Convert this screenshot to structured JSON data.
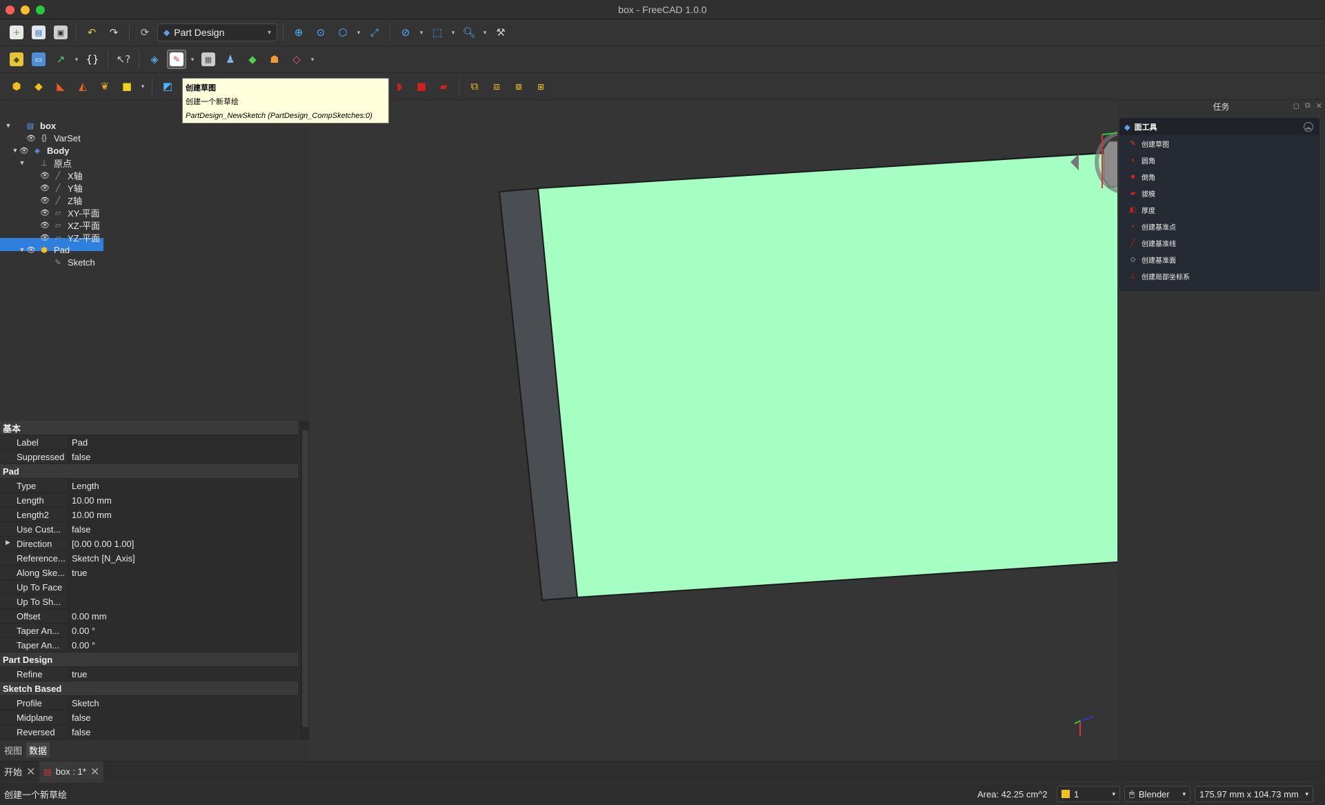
{
  "window": {
    "title": "box - FreeCAD 1.0.0"
  },
  "traffic_colors": [
    "#ff5f57",
    "#febc2e",
    "#28c840"
  ],
  "workbench": {
    "selected": "Part Design"
  },
  "tooltip": {
    "title": "创建草图",
    "description": "创建一个新草绘",
    "command": "PartDesign_NewSketch (PartDesign_CompSketches:0)"
  },
  "tree": {
    "rows": [
      {
        "label": "box",
        "depth": 0,
        "arrow": "▼",
        "eye": "",
        "icon": "document-icon",
        "bold": true
      },
      {
        "label": "VarSet",
        "depth": 2,
        "arrow": "",
        "eye": "👁",
        "icon": "braces-icon",
        "bold": false
      },
      {
        "label": "Body",
        "depth": 1,
        "arrow": "▼",
        "eye": "👁",
        "icon": "body-icon",
        "bold": true
      },
      {
        "label": "原点",
        "depth": 2,
        "arrow": "▼",
        "eye": "",
        "icon": "origin-icon",
        "bold": false
      },
      {
        "label": "X轴",
        "depth": 4,
        "arrow": "",
        "eye": "👁",
        "icon": "axis-icon",
        "bold": false
      },
      {
        "label": "Y轴",
        "depth": 4,
        "arrow": "",
        "eye": "👁",
        "icon": "axis-icon",
        "bold": false
      },
      {
        "label": "Z轴",
        "depth": 4,
        "arrow": "",
        "eye": "👁",
        "icon": "axis-icon",
        "bold": false
      },
      {
        "label": "XY-平面",
        "depth": 4,
        "arrow": "",
        "eye": "👁",
        "icon": "plane-icon",
        "bold": false
      },
      {
        "label": "XZ-平面",
        "depth": 4,
        "arrow": "",
        "eye": "👁",
        "icon": "plane-icon",
        "bold": false
      },
      {
        "label": "YZ-平面",
        "depth": 4,
        "arrow": "",
        "eye": "👁",
        "icon": "plane-icon",
        "bold": false
      },
      {
        "label": "Pad",
        "depth": 2,
        "arrow": "▼",
        "eye": "👁",
        "icon": "pad-icon",
        "bold": false
      },
      {
        "label": "Sketch",
        "depth": 4,
        "arrow": "",
        "eye": "",
        "icon": "sketch-icon",
        "bold": false
      }
    ]
  },
  "properties": {
    "rows": [
      {
        "group": "基本"
      },
      {
        "k": "Label",
        "v": "Pad"
      },
      {
        "k": "Suppressed",
        "v": "false"
      },
      {
        "group": "Pad"
      },
      {
        "k": "Type",
        "v": "Length"
      },
      {
        "k": "Length",
        "v": "10.00 mm"
      },
      {
        "k": "Length2",
        "v": "10.00 mm"
      },
      {
        "k": "Use Cust...",
        "v": "false"
      },
      {
        "k": "Direction",
        "v": "[0.00 0.00 1.00]",
        "expand": "▶"
      },
      {
        "k": "Reference...",
        "v": "Sketch [N_Axis]"
      },
      {
        "k": "Along Ske...",
        "v": "true"
      },
      {
        "k": "Up To Face",
        "v": ""
      },
      {
        "k": "Up To Sh...",
        "v": ""
      },
      {
        "k": "Offset",
        "v": "0.00 mm"
      },
      {
        "k": "Taper An...",
        "v": "0.00 °"
      },
      {
        "k": "Taper An...",
        "v": "0.00 °"
      },
      {
        "group": "Part Design"
      },
      {
        "k": "Refine",
        "v": "true"
      },
      {
        "group": "Sketch Based"
      },
      {
        "k": "Profile",
        "v": "Sketch"
      },
      {
        "k": "Midplane",
        "v": "false"
      },
      {
        "k": "Reversed",
        "v": "false"
      }
    ],
    "tabs": [
      "视图",
      "数据"
    ],
    "active_tab": "数据"
  },
  "doc_tabs": [
    {
      "label": "开始",
      "active": false
    },
    {
      "label": "box : 1*",
      "active": true
    }
  ],
  "status": {
    "message": "创建一个新草绘",
    "area": "Area: 42.25 cm^2",
    "layer": "1",
    "nav_style": "Blender",
    "dimensions": "175.97 mm x 104.73 mm"
  },
  "tasks": {
    "title": "任务",
    "panel_title": "面工具",
    "items": [
      {
        "label": "创建草图",
        "icon": "sketch-icon",
        "color": "#d83b3b"
      },
      {
        "label": "圆角",
        "icon": "fillet-icon",
        "color": "#d02020"
      },
      {
        "label": "倒角",
        "icon": "chamfer-icon",
        "color": "#d02020"
      },
      {
        "label": "拔模",
        "icon": "draft-icon",
        "color": "#d02020"
      },
      {
        "label": "厚度",
        "icon": "thickness-icon",
        "color": "#d02020"
      },
      {
        "label": "创建基准点",
        "icon": "datum-point-icon",
        "color": "#d02020"
      },
      {
        "label": "创建基准线",
        "icon": "datum-line-icon",
        "color": "#d02020"
      },
      {
        "label": "创建基准面",
        "icon": "datum-plane-icon",
        "color": "#cccccc"
      },
      {
        "label": "创建局部坐标系",
        "icon": "local-cs-icon",
        "color": "#d02020"
      }
    ]
  },
  "colors": {
    "face": "#a5ffc3",
    "side": "#4a4d51",
    "selection": "#2f7fdc"
  }
}
